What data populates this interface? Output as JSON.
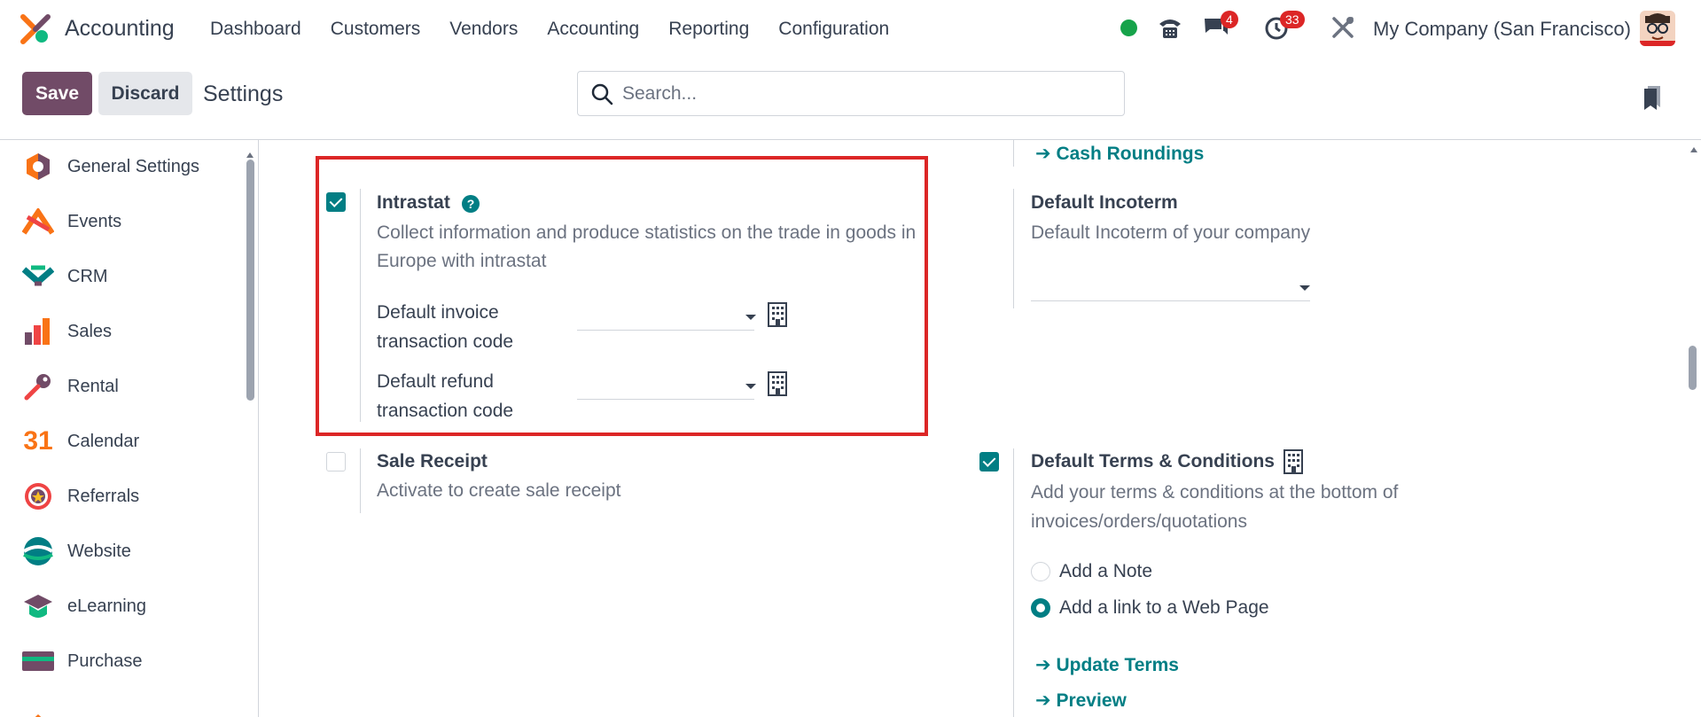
{
  "navbar": {
    "app_name": "Accounting",
    "menu": [
      "Dashboard",
      "Customers",
      "Vendors",
      "Accounting",
      "Reporting",
      "Configuration"
    ],
    "messages_badge": "4",
    "activities_badge": "33",
    "company": "My Company (San Francisco)"
  },
  "control_panel": {
    "save_label": "Save",
    "discard_label": "Discard",
    "title": "Settings",
    "search_placeholder": "Search..."
  },
  "sidebar": {
    "items": [
      {
        "label": "General Settings",
        "icon": "general-settings-icon"
      },
      {
        "label": "Events",
        "icon": "events-icon"
      },
      {
        "label": "CRM",
        "icon": "crm-icon"
      },
      {
        "label": "Sales",
        "icon": "sales-icon"
      },
      {
        "label": "Rental",
        "icon": "rental-icon"
      },
      {
        "label": "Calendar",
        "icon": "calendar-icon"
      },
      {
        "label": "Referrals",
        "icon": "referrals-icon"
      },
      {
        "label": "Website",
        "icon": "website-icon"
      },
      {
        "label": "eLearning",
        "icon": "elearning-icon"
      },
      {
        "label": "Purchase",
        "icon": "purchase-icon"
      }
    ]
  },
  "settings": {
    "cash_roundings_link": "Cash Roundings",
    "intrastat": {
      "checked": true,
      "title": "Intrastat",
      "description": "Collect information and produce statistics on the trade in goods in Europe with intrastat",
      "invoice_label": "Default invoice transaction code",
      "refund_label": "Default refund transaction code",
      "invoice_value": "",
      "refund_value": ""
    },
    "incoterm": {
      "title": "Default Incoterm",
      "description": "Default Incoterm of your company",
      "value": ""
    },
    "sale_receipt": {
      "checked": false,
      "title": "Sale Receipt",
      "description": "Activate to create sale receipt"
    },
    "terms": {
      "checked": true,
      "title": "Default Terms & Conditions",
      "description": "Add your terms & conditions at the bottom of invoices/orders/quotations",
      "option_note": "Add a Note",
      "option_link": "Add a link to a Web Page",
      "selected": "Add a link to a Web Page",
      "update_link": "Update Terms",
      "preview_link": "Preview"
    }
  },
  "colors": {
    "brand": "#714b67",
    "accent": "#017e84",
    "highlight": "#dc2626"
  }
}
